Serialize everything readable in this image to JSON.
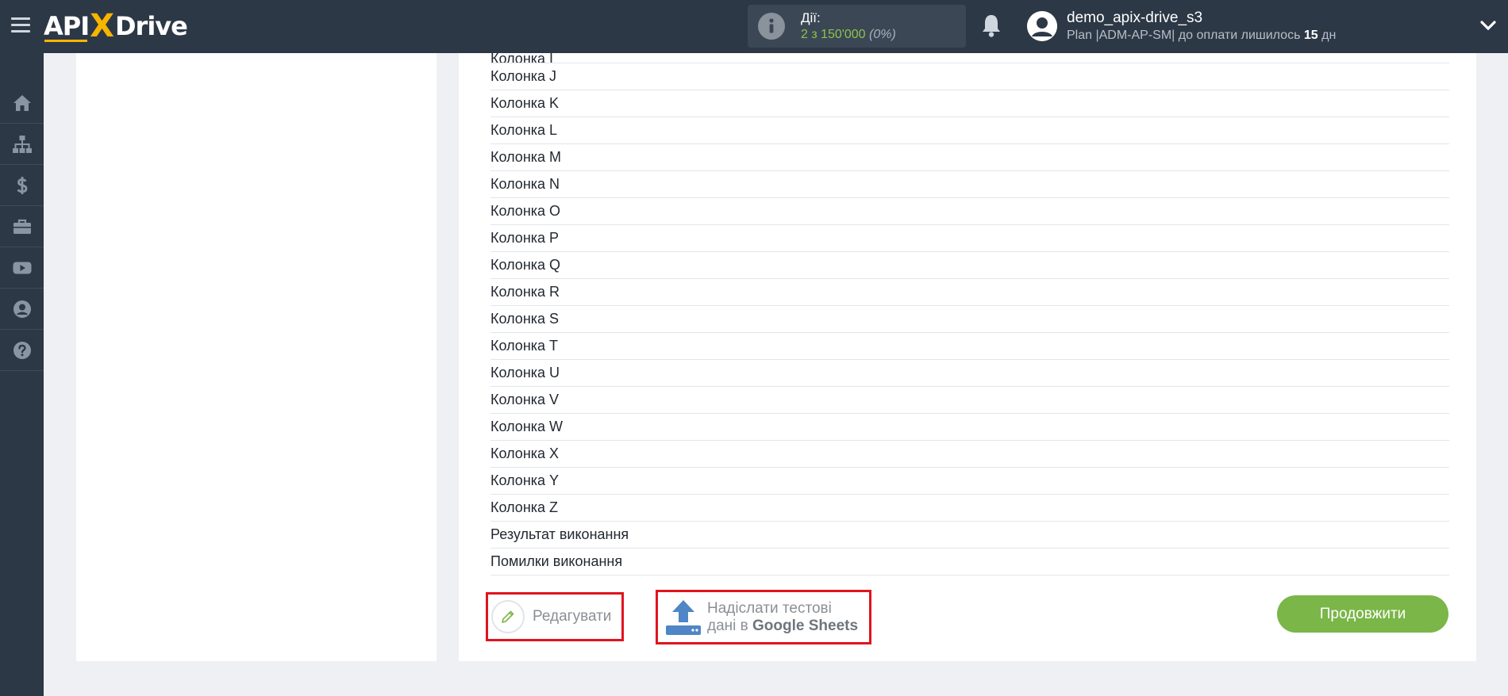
{
  "header": {
    "logo": {
      "part1": "API",
      "part2": "X",
      "part3": "Drive"
    },
    "actions": {
      "label": "Дії:",
      "count": "2 з 150'000",
      "percent": "(0%)"
    },
    "user": {
      "name": "demo_apix-drive_s3",
      "plan_prefix": "Plan |ADM-AP-SM| до оплати лишилось ",
      "days": "15",
      "days_suffix": " дн"
    }
  },
  "sidebar": {
    "items": [
      "home-icon",
      "sitemap-icon",
      "dollar-icon",
      "briefcase-icon",
      "youtube-icon",
      "user-icon",
      "help-icon"
    ]
  },
  "main": {
    "partial_row": "Колонка I",
    "rows": [
      "Колонка J",
      "Колонка K",
      "Колонка L",
      "Колонка M",
      "Колонка N",
      "Колонка O",
      "Колонка P",
      "Колонка Q",
      "Колонка R",
      "Колонка S",
      "Колонка T",
      "Колонка U",
      "Колонка V",
      "Колонка W",
      "Колонка X",
      "Колонка Y",
      "Колонка Z",
      "Результат виконання",
      "Помилки виконання"
    ],
    "edit_label": "Редагувати",
    "send_line1": "Надіслати тестові",
    "send_line2_prefix": "дані в ",
    "send_line2_bold": "Google Sheets",
    "continue_label": "Продовжити"
  },
  "colors": {
    "header_bg": "#2d3846",
    "accent_green": "#7ab648",
    "highlight_red": "#e0141e",
    "logo_yellow": "#f7b500"
  }
}
